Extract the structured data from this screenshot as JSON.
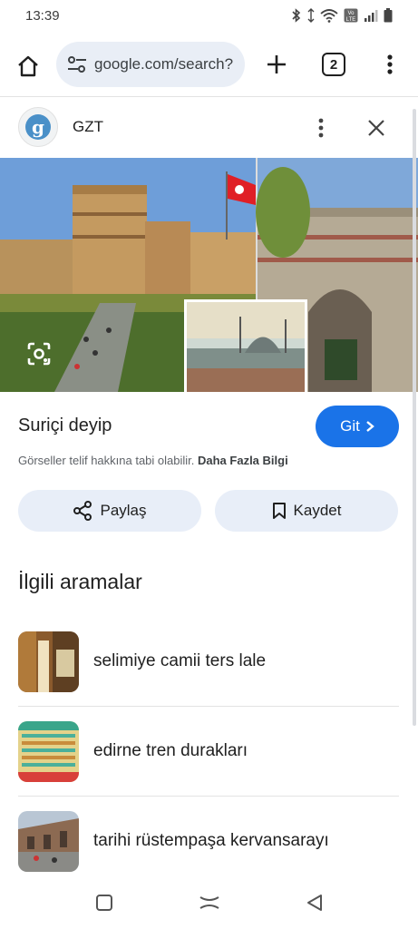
{
  "status_bar": {
    "time": "13:39"
  },
  "toolbar": {
    "url": "google.com/search?",
    "tab_count": "2"
  },
  "source": {
    "name": "GZT",
    "avatar_letter": "g"
  },
  "result": {
    "title": "Suriçi deyip",
    "visit_label": "Git",
    "copyright_text": "Görseller telif hakkına tabi olabilir.",
    "learn_more": "Daha Fazla Bilgi"
  },
  "actions": {
    "share_label": "Paylaş",
    "save_label": "Kaydet"
  },
  "related": {
    "heading": "İlgili aramalar",
    "items": [
      {
        "label": "selimiye camii ters lale"
      },
      {
        "label": "edirne tren durakları"
      },
      {
        "label": "tarihi rüstempaşa kervansarayı"
      }
    ]
  },
  "colors": {
    "accent": "#1a73e8",
    "pill_bg": "#e8eef8",
    "omnibox_bg": "#e9eef6"
  },
  "icons": [
    "home-icon",
    "tune-icon",
    "plus-icon",
    "tabs-icon",
    "more-vert-icon",
    "close-icon",
    "lens-icon",
    "chevron-right-icon",
    "share-icon",
    "bookmark-icon",
    "square-nav-icon",
    "home-nav-icon",
    "back-nav-icon"
  ]
}
